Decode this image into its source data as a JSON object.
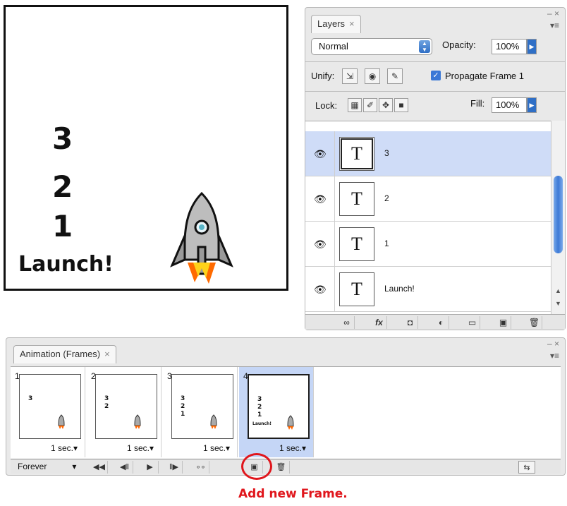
{
  "canvas": {
    "lines": [
      "3",
      "2",
      "1",
      "Launch!"
    ]
  },
  "layers_panel": {
    "tab_label": "Layers",
    "close_glyph": "×",
    "window_controls": "– ×",
    "menu_glyph": "▾≡",
    "blend_mode": "Normal",
    "opacity_label": "Opacity:",
    "opacity_value": "100%",
    "unify_label": "Unify:",
    "propagate_label": "Propagate Frame 1",
    "lock_label": "Lock:",
    "fill_label": "Fill:",
    "fill_value": "100%",
    "layers": [
      {
        "name": "3",
        "thumb": "T",
        "selected": true
      },
      {
        "name": "2",
        "thumb": "T",
        "selected": false
      },
      {
        "name": "1",
        "thumb": "T",
        "selected": false
      },
      {
        "name": "Launch!",
        "thumb": "T",
        "selected": false
      }
    ],
    "bottom_icons": [
      "link-icon",
      "fx-icon",
      "mask-icon",
      "adjustment-icon",
      "folder-icon",
      "new-layer-icon",
      "trash-icon"
    ]
  },
  "animation_panel": {
    "tab_label": "Animation (Frames)",
    "close_glyph": "×",
    "window_controls": "– ×",
    "menu_glyph": "▾≡",
    "loop_label": "Forever",
    "frames": [
      {
        "number": "1",
        "delay": "1 sec.",
        "selected": false
      },
      {
        "number": "2",
        "delay": "1 sec.",
        "selected": false
      },
      {
        "number": "3",
        "delay": "1 sec.",
        "selected": false
      },
      {
        "number": "4",
        "delay": "1 sec.",
        "selected": true
      }
    ]
  },
  "callout": "Add new Frame.",
  "colors": {
    "accent": "#e0161c",
    "selection": "#cfdcf7"
  }
}
